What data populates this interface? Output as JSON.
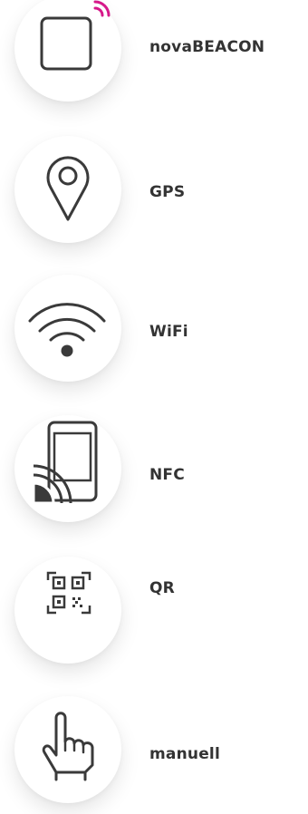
{
  "options": [
    {
      "label": "novaBEACON",
      "icon": "beacon-icon"
    },
    {
      "label": "GPS",
      "icon": "map-pin-icon"
    },
    {
      "label": "WiFi",
      "icon": "wifi-icon"
    },
    {
      "label": "NFC",
      "icon": "nfc-phone-icon"
    },
    {
      "label": "QR",
      "icon": "qr-scan-icon"
    },
    {
      "label": "manuell",
      "icon": "hand-pointer-icon"
    }
  ],
  "colors": {
    "icon": "#3a3a3a",
    "accent": "#d6198a",
    "text": "#333333"
  }
}
